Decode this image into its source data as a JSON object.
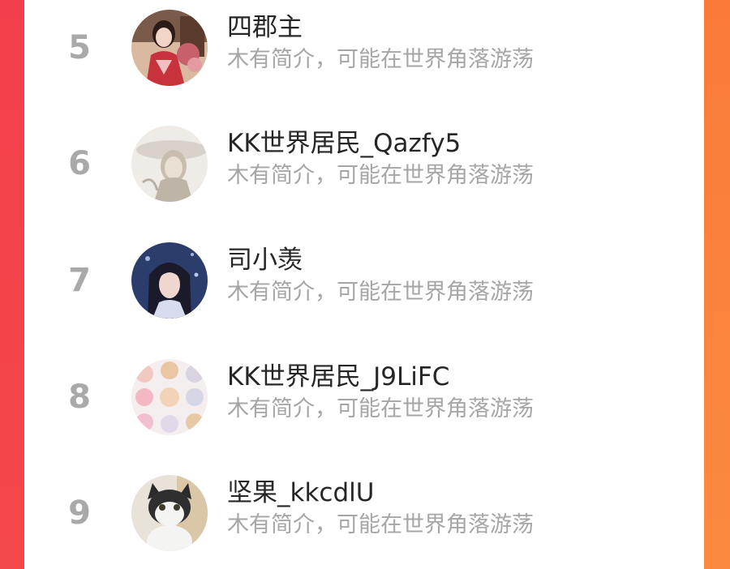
{
  "theme": {
    "panel": "#ffffff",
    "accent_left": "#f33f4b",
    "accent_right": "#fb7a3a",
    "rank_color": "#a9a9a9",
    "name_color": "#262626",
    "bio_color": "#a6a6a6"
  },
  "users": [
    {
      "rank": "5",
      "name": "四郡主",
      "bio": "木有简介，可能在世界角落游荡",
      "avatar_icon": "avatar-girl-red-kimono"
    },
    {
      "rank": "6",
      "name": "KK世界居民_Qazfy5",
      "bio": "木有简介，可能在世界角落游荡",
      "avatar_icon": "avatar-ink-drawing"
    },
    {
      "rank": "7",
      "name": "司小羡",
      "bio": "木有简介，可能在世界角落游荡",
      "avatar_icon": "avatar-anime-character"
    },
    {
      "rank": "8",
      "name": "KK世界居民_J9LiFC",
      "bio": "木有简介，可能在世界角落游荡",
      "avatar_icon": "avatar-chibi-grid"
    },
    {
      "rank": "9",
      "name": "坚果_kkcdlU",
      "bio": "木有简介，可能在世界角落游荡",
      "avatar_icon": "avatar-cat"
    }
  ]
}
